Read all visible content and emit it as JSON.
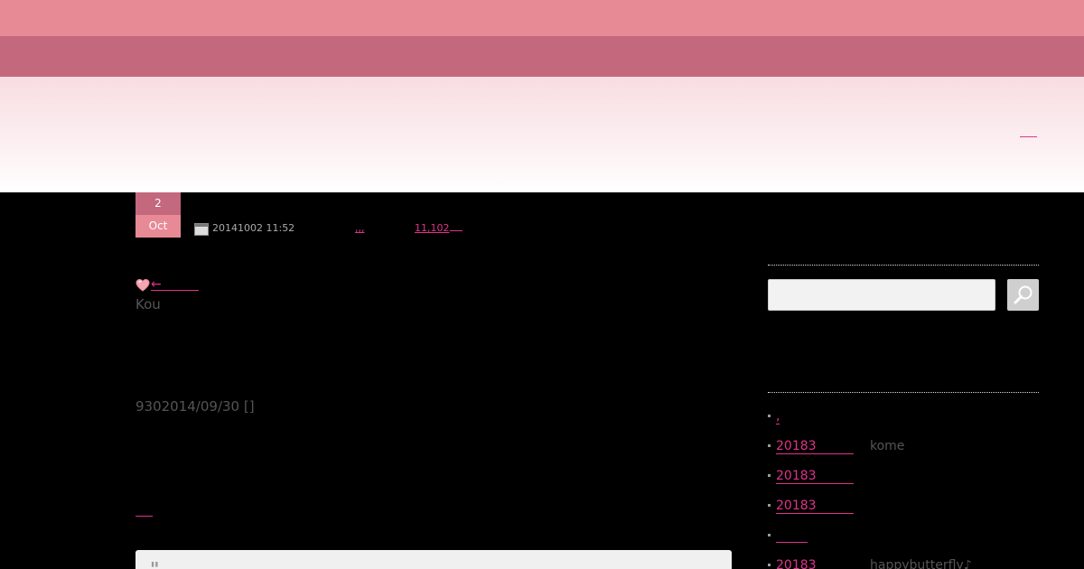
{
  "post": {
    "day": "2",
    "month": "Oct",
    "datetime": "20141002 11:52",
    "category": ",,,",
    "views": "11,102",
    "back_arrow": "←",
    "author": "Kou",
    "reference": "9302014/09/30 []",
    "quote_mark": "\""
  },
  "sidebar": {
    "search": {
      "placeholder": ""
    },
    "items": [
      {
        "link": ",",
        "extra": ""
      },
      {
        "link": "20183",
        "extra": "kome"
      },
      {
        "link": "20183",
        "extra": ""
      },
      {
        "link": "20183",
        "extra": ""
      },
      {
        "link": "",
        "extra": ""
      },
      {
        "link": "20183",
        "extra": "happybutterfly♪"
      }
    ]
  },
  "colors": {
    "top_stripe": "#e88a96",
    "nav_bar": "#c4687e",
    "link": "#e0338a"
  },
  "icons": {
    "calendar": "calendar-icon",
    "heart": "heart-icon",
    "search": "search-icon"
  }
}
